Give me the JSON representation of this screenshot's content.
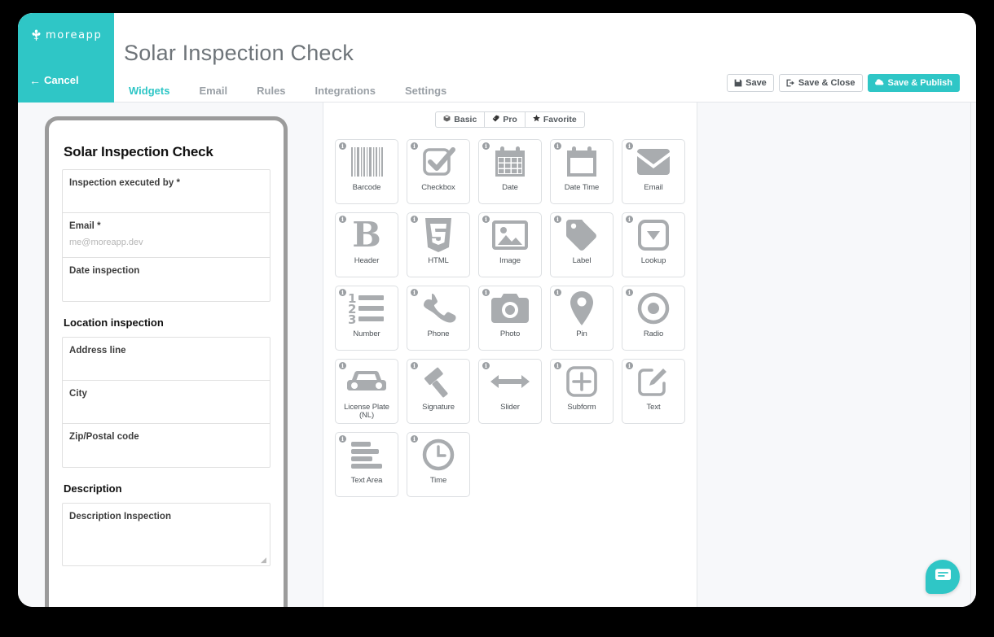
{
  "brand": {
    "name": "moreapp",
    "logo_icon": "leaf-icon",
    "color": "#2fc6c6"
  },
  "header": {
    "cancel_label": "Cancel",
    "back_arrow_icon": "arrow-left-icon",
    "title": "Solar Inspection Check",
    "tabs": [
      {
        "label": "Widgets",
        "active": true
      },
      {
        "label": "Email",
        "active": false
      },
      {
        "label": "Rules",
        "active": false
      },
      {
        "label": "Integrations",
        "active": false
      },
      {
        "label": "Settings",
        "active": false
      }
    ],
    "actions": [
      {
        "label": "Save",
        "icon": "floppy-disk-icon",
        "primary": false
      },
      {
        "label": "Save & Close",
        "icon": "sign-out-icon",
        "primary": false
      },
      {
        "label": "Save & Publish",
        "icon": "cloud-upload-icon",
        "primary": true
      }
    ]
  },
  "preview": {
    "form_title": "Solar Inspection Check",
    "blocks": [
      {
        "type": "group",
        "fields": [
          {
            "label": "Inspection executed by *",
            "placeholder": ""
          },
          {
            "label": "Email *",
            "placeholder": "me@moreapp.dev"
          },
          {
            "label": "Date inspection",
            "placeholder": ""
          }
        ]
      },
      {
        "type": "section",
        "title": "Location inspection",
        "fields": [
          {
            "label": "Address line",
            "placeholder": ""
          },
          {
            "label": "City",
            "placeholder": ""
          },
          {
            "label": "Zip/Postal code",
            "placeholder": ""
          }
        ]
      },
      {
        "type": "textarea-section",
        "title": "Description",
        "field": {
          "label": "Description Inspection",
          "placeholder": ""
        }
      }
    ]
  },
  "widgets": {
    "filters": [
      {
        "label": "Basic",
        "icon": "cube-icon",
        "active": false
      },
      {
        "label": "Pro",
        "icon": "tag-icon",
        "active": false
      },
      {
        "label": "Favorite",
        "icon": "star-icon",
        "active": false
      }
    ],
    "info_badge": "i",
    "items": [
      {
        "label": "Barcode",
        "icon": "barcode-icon"
      },
      {
        "label": "Checkbox",
        "icon": "checkbox-icon"
      },
      {
        "label": "Date",
        "icon": "calendar-icon"
      },
      {
        "label": "Date Time",
        "icon": "calendar-blank-icon"
      },
      {
        "label": "Email",
        "icon": "envelope-icon"
      },
      {
        "label": "Header",
        "icon": "bold-b-icon"
      },
      {
        "label": "HTML",
        "icon": "html5-shield-icon"
      },
      {
        "label": "Image",
        "icon": "image-icon"
      },
      {
        "label": "Label",
        "icon": "price-tag-icon"
      },
      {
        "label": "Lookup",
        "icon": "dropdown-icon"
      },
      {
        "label": "Number",
        "icon": "ordered-list-icon"
      },
      {
        "label": "Phone",
        "icon": "phone-icon"
      },
      {
        "label": "Photo",
        "icon": "camera-icon"
      },
      {
        "label": "Pin",
        "icon": "map-pin-icon"
      },
      {
        "label": "Radio",
        "icon": "radio-button-icon"
      },
      {
        "label": "License Plate (NL)",
        "icon": "car-icon"
      },
      {
        "label": "Signature",
        "icon": "gavel-icon"
      },
      {
        "label": "Slider",
        "icon": "arrows-horizontal-icon"
      },
      {
        "label": "Subform",
        "icon": "plus-square-icon"
      },
      {
        "label": "Text",
        "icon": "pencil-square-icon"
      },
      {
        "label": "Text Area",
        "icon": "text-lines-icon"
      },
      {
        "label": "Time",
        "icon": "clock-icon"
      }
    ]
  },
  "chat": {
    "icon": "chat-message-icon",
    "color": "#2fc6c6"
  }
}
